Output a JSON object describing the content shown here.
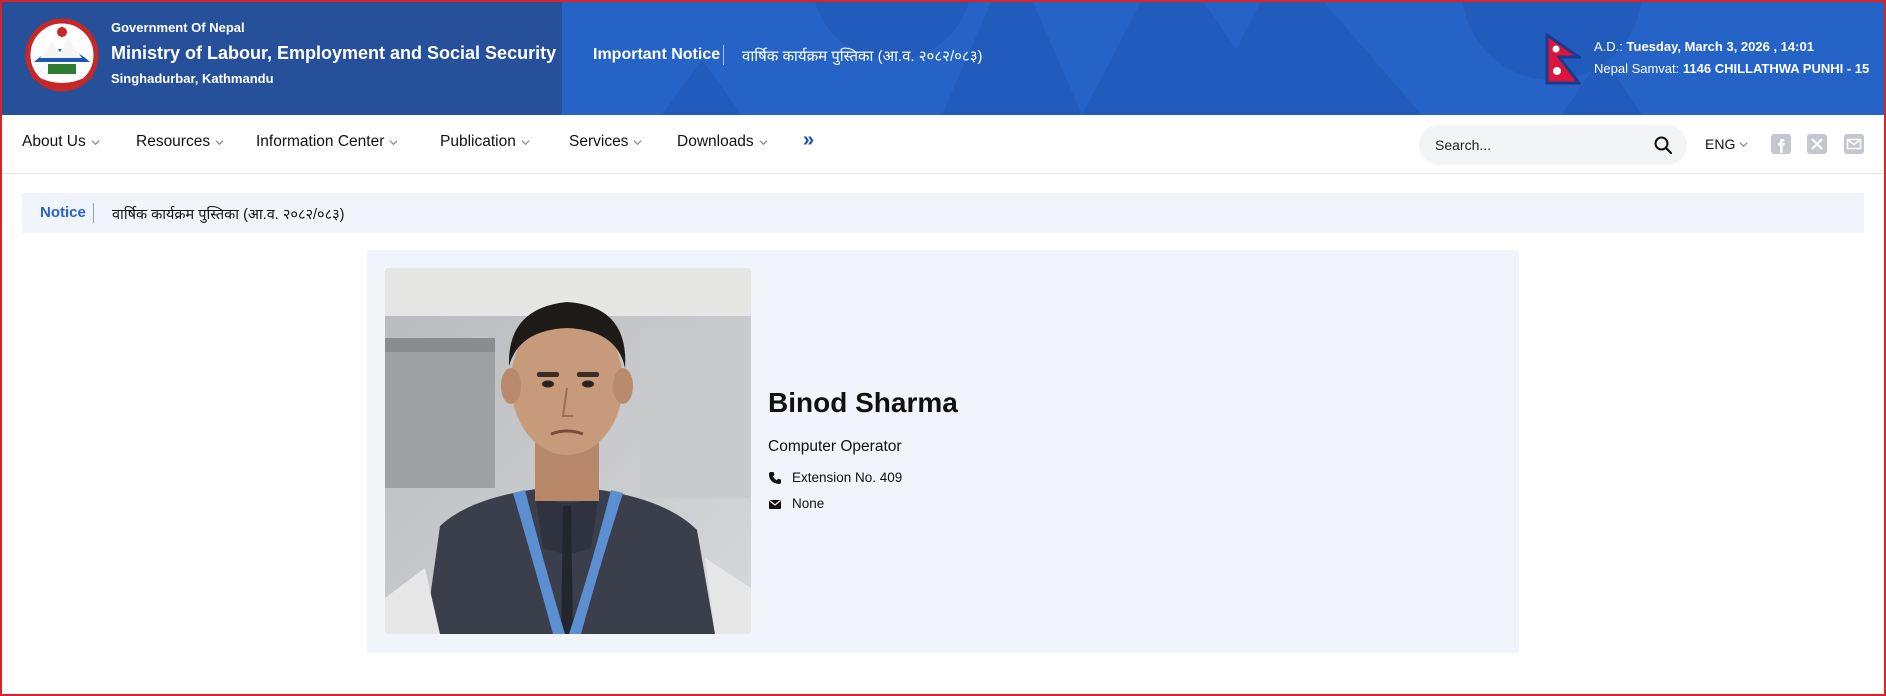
{
  "header": {
    "gov_name": "Government Of Nepal",
    "ministry": "Ministry of Labour, Employment and Social Security",
    "location": "Singhadurbar, Kathmandu",
    "important_label": "Important Notice",
    "important_text": "वार्षिक कार्यक्रम पुस्तिका (आ.व. २०८२/०८३)",
    "ad_label": "A.D.:",
    "ad_value": "Tuesday, March 3, 2026 , 14:01",
    "samvat_label": "Nepal Samvat:",
    "samvat_value": "1146 CHILLATHWA PUNHI - 15",
    "colors": {
      "left_panel": "#27509a",
      "banner": "#2563c6"
    }
  },
  "nav": {
    "items": [
      {
        "label": "About Us"
      },
      {
        "label": "Resources"
      },
      {
        "label": "Information Center"
      },
      {
        "label": "Publication"
      },
      {
        "label": "Services"
      },
      {
        "label": "Downloads"
      }
    ],
    "more_glyph": "»",
    "search_placeholder": "Search...",
    "language": "ENG",
    "social": [
      "facebook-icon",
      "x-twitter-icon",
      "mail-icon"
    ]
  },
  "notice": {
    "label": "Notice",
    "text": "वार्षिक कार्यक्रम पुस्तिका (आ.व. २०८२/०८३)"
  },
  "profile": {
    "name": "Binod Sharma",
    "role": "Computer Operator",
    "extension": "Extension No. 409",
    "email": "None"
  }
}
